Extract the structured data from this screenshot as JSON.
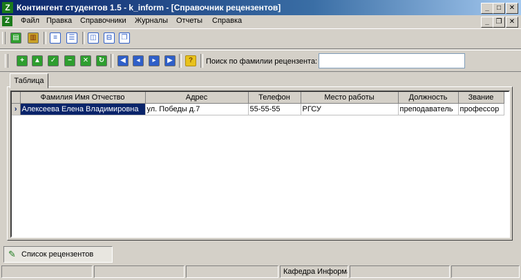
{
  "window": {
    "title": "Контингент студентов 1.5 - k_inform - [Справочник рецензентов]",
    "app_icon": "app-logo-icon",
    "controls": [
      "minimize",
      "maximize",
      "close"
    ]
  },
  "mdi_controls": [
    "restore",
    "close"
  ],
  "menu": [
    "Файл",
    "Правка",
    "Справочники",
    "Журналы",
    "Отчеты",
    "Справка"
  ],
  "toolbar_top": {
    "icons": [
      "exit-icon",
      "books-icon",
      "document-icon",
      "document-list-icon",
      "tile-vertical-icon",
      "tile-horizontal-icon",
      "cascade-icon"
    ]
  },
  "toolbar_nav": {
    "icons": [
      "insert-record-icon",
      "move-up-icon",
      "post-record-icon",
      "delete-record-icon",
      "cancel-record-icon",
      "refresh-icon",
      "first-record-icon",
      "prior-record-icon",
      "next-record-icon",
      "last-record-icon",
      "help-icon"
    ],
    "colors": {
      "green": "#2e9e2e",
      "blue": "#2f5fc8",
      "yellow": "#e8c21c"
    }
  },
  "search": {
    "label": "Поиск по фамилии рецензента:",
    "value": "",
    "placeholder": ""
  },
  "tabs": [
    "Таблица"
  ],
  "grid": {
    "columns": [
      "Фамилия Имя Отчество",
      "Адрес",
      "Телефон",
      "Место работы",
      "Должность",
      "Звание"
    ],
    "rows": [
      [
        "Алексеева Елена Владимировна",
        "ул. Победы д.7",
        "55-55-55",
        "РГСУ",
        "преподаватель",
        "профессор"
      ]
    ],
    "selected_row": 0,
    "selection_color": "#0a246a",
    "row_indicator": "›"
  },
  "taskbar": {
    "window_button": "Список рецензентов",
    "icon": "people-icon"
  },
  "statusbar": [
    "",
    "",
    "",
    "Кафедра Информа",
    "",
    ""
  ]
}
